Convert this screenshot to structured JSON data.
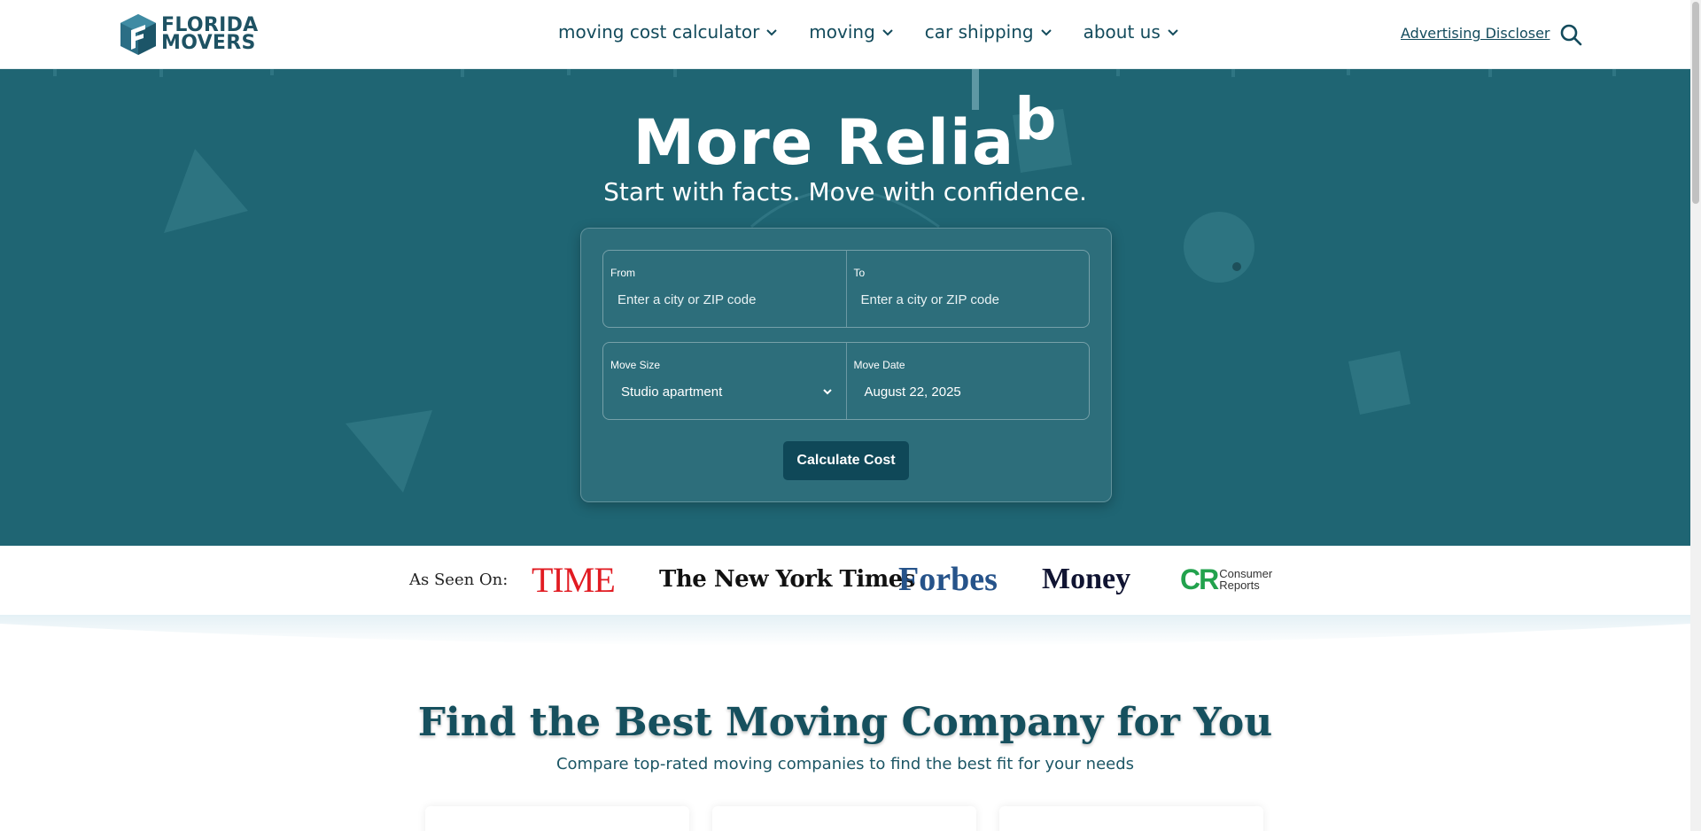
{
  "header": {
    "logo_line1": "FLORIDA",
    "logo_line2": "MOVERS",
    "nav": [
      {
        "label": "moving cost calculator",
        "icon": "chevron-down-icon"
      },
      {
        "label": "moving",
        "icon": "chevron-down-icon"
      },
      {
        "label": "car shipping",
        "icon": "chevron-down-icon"
      },
      {
        "label": "about us",
        "icon": "chevron-down-icon"
      }
    ],
    "advertising_link": "Advertising Discloser",
    "search_icon": "search-icon"
  },
  "hero": {
    "title": "More Relia",
    "title_typing_char": "b",
    "subtitle": "Start with facts. Move with confidence.",
    "form": {
      "from_label": "From",
      "from_placeholder": "Enter a city or ZIP code",
      "to_label": "To",
      "to_placeholder": "Enter a city or ZIP code",
      "size_label": "Move Size",
      "size_value": "Studio apartment",
      "date_label": "Move Date",
      "date_value": "August 22, 2025",
      "submit_label": "Calculate Cost"
    }
  },
  "press": {
    "label": "As Seen On:",
    "logos": {
      "time": "TIME",
      "nyt": "The New York Times",
      "forbes": "Forbes",
      "money": "Money",
      "cr_mark": "CR",
      "cr_line1": "Consumer",
      "cr_line2": "Reports"
    }
  },
  "section": {
    "title": "Find the Best Moving Company for You",
    "subtitle": "Compare top-rated moving companies to find the best fit for your needs"
  },
  "colors": {
    "hero_bg": "#1f6573",
    "brand_dark": "#0f4858",
    "time_red": "#e11b22",
    "forbes_blue": "#26538a",
    "cr_green": "#22a24d"
  }
}
